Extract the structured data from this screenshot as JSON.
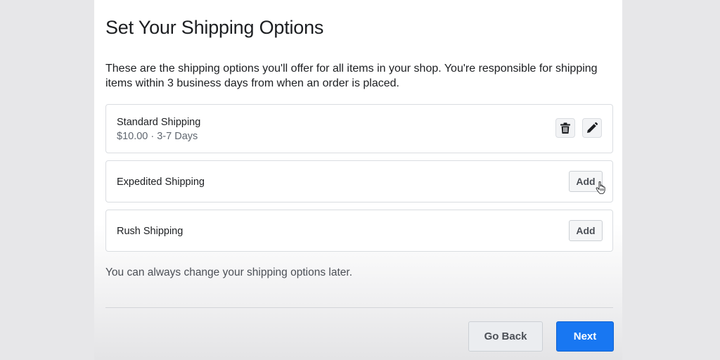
{
  "title": "Set Your Shipping Options",
  "intro": "These are the shipping options you'll offer for all items in your shop. You're responsible for shipping items within 3 business days from when an order is placed.",
  "options": [
    {
      "name": "Standard Shipping",
      "details": "$10.00 · 3-7 Days",
      "actions": [
        "trash-icon",
        "pencil-icon"
      ]
    },
    {
      "name": "Expedited Shipping",
      "add_label": "Add"
    },
    {
      "name": "Rush Shipping",
      "add_label": "Add"
    }
  ],
  "note": "You can always change your shipping options later.",
  "footer": {
    "back_label": "Go Back",
    "next_label": "Next"
  },
  "colors": {
    "primary": "#1877f2",
    "text": "#1c1e21",
    "secondary_text": "#606770"
  }
}
